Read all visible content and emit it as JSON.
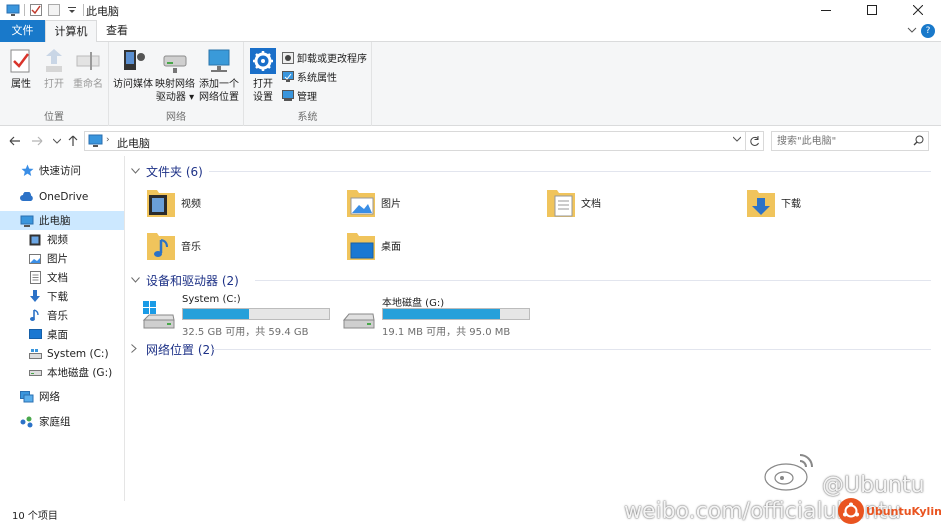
{
  "window": {
    "title": "此电脑"
  },
  "ribbon": {
    "tabs": [
      {
        "label": "文件"
      },
      {
        "label": "计算机"
      },
      {
        "label": "查看"
      }
    ],
    "groups": {
      "location": {
        "label": "位置",
        "buttons": [
          {
            "label": "属性"
          },
          {
            "label": "打开"
          },
          {
            "label": "重命名"
          }
        ]
      },
      "network": {
        "label": "网络",
        "buttons": [
          {
            "line1": "访问媒体",
            "line2": ""
          },
          {
            "line1": "映射网络",
            "line2": "驱动器 ▾"
          },
          {
            "line1": "添加一个",
            "line2": "网络位置"
          }
        ]
      },
      "system": {
        "label": "系统",
        "open": {
          "line1": "打开",
          "line2": "设置"
        },
        "small": [
          {
            "label": "卸载或更改程序"
          },
          {
            "label": "系统属性"
          },
          {
            "label": "管理"
          }
        ]
      }
    }
  },
  "address": {
    "crumb": "此电脑",
    "search_placeholder": "搜索\"此电脑\""
  },
  "nav": {
    "items": [
      {
        "label": "快速访问",
        "icon": "star-icon"
      },
      {
        "label": "OneDrive",
        "icon": "cloud-icon"
      },
      {
        "label": "此电脑",
        "icon": "computer-icon"
      },
      {
        "label": "视频",
        "icon": "video-icon"
      },
      {
        "label": "图片",
        "icon": "picture-icon"
      },
      {
        "label": "文档",
        "icon": "document-icon"
      },
      {
        "label": "下载",
        "icon": "download-icon"
      },
      {
        "label": "音乐",
        "icon": "music-icon"
      },
      {
        "label": "桌面",
        "icon": "desktop-icon"
      },
      {
        "label": "System (C:)",
        "icon": "drive-c-icon"
      },
      {
        "label": "本地磁盘 (G:)",
        "icon": "drive-g-icon"
      },
      {
        "label": "网络",
        "icon": "network-icon"
      },
      {
        "label": "家庭组",
        "icon": "homegroup-icon"
      }
    ]
  },
  "sections": {
    "folders": {
      "title": "文件夹 (6)",
      "items": [
        {
          "label": "视频"
        },
        {
          "label": "图片"
        },
        {
          "label": "文档"
        },
        {
          "label": "下载"
        },
        {
          "label": "音乐"
        },
        {
          "label": "桌面"
        }
      ]
    },
    "drives": {
      "title": "设备和驱动器 (2)",
      "items": [
        {
          "name": "System (C:)",
          "info": "32.5 GB 可用，共 59.4 GB",
          "used_fraction": 0.453
        },
        {
          "name": "本地磁盘 (G:)",
          "info": "19.1 MB 可用，共 95.0 MB",
          "used_fraction": 0.799
        }
      ]
    },
    "network": {
      "title": "网络位置 (2)"
    }
  },
  "status": {
    "count": "10 个项目"
  },
  "watermark": {
    "handle": "@Ubuntu",
    "url": "weibo.com/officialubuntu",
    "brand": "UbuntuKylin"
  },
  "colors": {
    "accent": "#1979ca",
    "selected": "#cce8ff",
    "drive_bar": "#26a0da",
    "folder": "#f0c45c"
  }
}
